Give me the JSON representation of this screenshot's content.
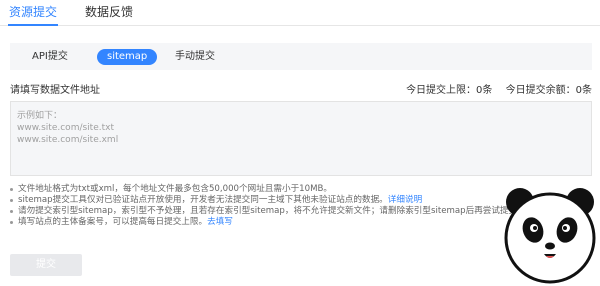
{
  "top_tabs": [
    {
      "label": "资源提交",
      "active": true
    },
    {
      "label": "数据反馈",
      "active": false
    }
  ],
  "sub_tabs": [
    {
      "label": "API提交",
      "active": false
    },
    {
      "label": "sitemap",
      "active": true
    },
    {
      "label": "手动提交",
      "active": false
    }
  ],
  "form": {
    "label": "请填写数据文件地址",
    "quota_limit": "今日提交上限：0条",
    "quota_remaining": "今日提交余额：0条",
    "placeholder": "示例如下：\nwww.site.com/site.txt\nwww.site.com/site.xml",
    "submit_label": "提交"
  },
  "notes": {
    "n1": "文件地址格式为txt或xml，每个地址文件最多包含50,000个网址且需小于10MB。",
    "n2": "sitemap提交工具仅对已验证站点开放使用，开发者无法提交同一主域下其他未验证站点的数据。",
    "n2_link": "详细说明",
    "n3": "请勿提交索引型sitemap，索引型不予处理，且若存在索引型sitemap，将不允许提交新文件；请删除索引型sitemap后再尝试提交。",
    "n4": "填写站点的主体备案号，可以提高每日提交上限。",
    "n4_link": "去填写"
  },
  "colors": {
    "accent": "#3385ff",
    "panel_bg": "#f5f6f8",
    "button_disabled": "#e8e9ec"
  },
  "icons": {
    "mascot": "panda-mascot"
  }
}
